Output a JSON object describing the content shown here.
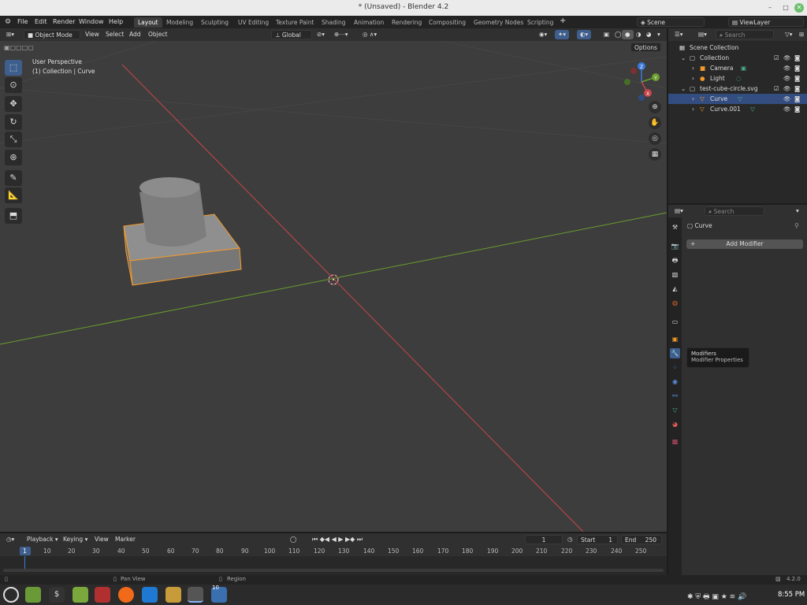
{
  "window": {
    "title": "* (Unsaved) - Blender 4.2"
  },
  "menu": {
    "items": [
      "File",
      "Edit",
      "Render",
      "Window",
      "Help"
    ]
  },
  "workspaces": [
    "Layout",
    "Modeling",
    "Sculpting",
    "UV Editing",
    "Texture Paint",
    "Shading",
    "Animation",
    "Rendering",
    "Compositing",
    "Geometry Nodes",
    "Scripting"
  ],
  "scene": {
    "name": "Scene",
    "view_layer": "ViewLayer"
  },
  "viewport_header": {
    "mode": "Object Mode",
    "menus": [
      "View",
      "Select",
      "Add",
      "Object"
    ],
    "orientation": "Global",
    "options": "Options"
  },
  "viewport": {
    "perspective": "User Perspective",
    "context": "(1) Collection | Curve"
  },
  "gizmo": {
    "x": "X",
    "y": "Y",
    "z": "Z"
  },
  "outliner": {
    "search_placeholder": "Search",
    "rows": [
      {
        "label": "Scene Collection"
      },
      {
        "label": "Collection"
      },
      {
        "label": "Camera"
      },
      {
        "label": "Light"
      },
      {
        "label": "test-cube-circle.svg"
      },
      {
        "label": "Curve"
      },
      {
        "label": "Curve.001"
      }
    ]
  },
  "properties": {
    "search_placeholder": "Search",
    "object_name": "Curve",
    "add_modifier": "Add Modifier",
    "tooltip_title": "Modifiers",
    "tooltip_desc": "Modifier Properties"
  },
  "timeline": {
    "menus": [
      "Playback",
      "Keying",
      "View",
      "Marker"
    ],
    "current_frame": "1",
    "start_label": "Start",
    "start": "1",
    "end_label": "End",
    "end": "250",
    "ticks": [
      "1",
      "10",
      "20",
      "30",
      "40",
      "50",
      "60",
      "70",
      "80",
      "90",
      "100",
      "110",
      "120",
      "130",
      "140",
      "150",
      "160",
      "170",
      "180",
      "190",
      "200",
      "210",
      "220",
      "230",
      "240",
      "250"
    ]
  },
  "statusbar": {
    "pan": "Pan View",
    "region": "Region",
    "version": "4.2.0"
  },
  "taskbar": {
    "time": "8:55 PM",
    "badge": "10"
  },
  "colors": {
    "accent": "#3e5f8e",
    "selection": "#334d80",
    "x_axis": "#c8464a",
    "y_axis": "#6a9e2c",
    "z_axis": "#3c78d8",
    "active_outline": "#f39a2b"
  }
}
